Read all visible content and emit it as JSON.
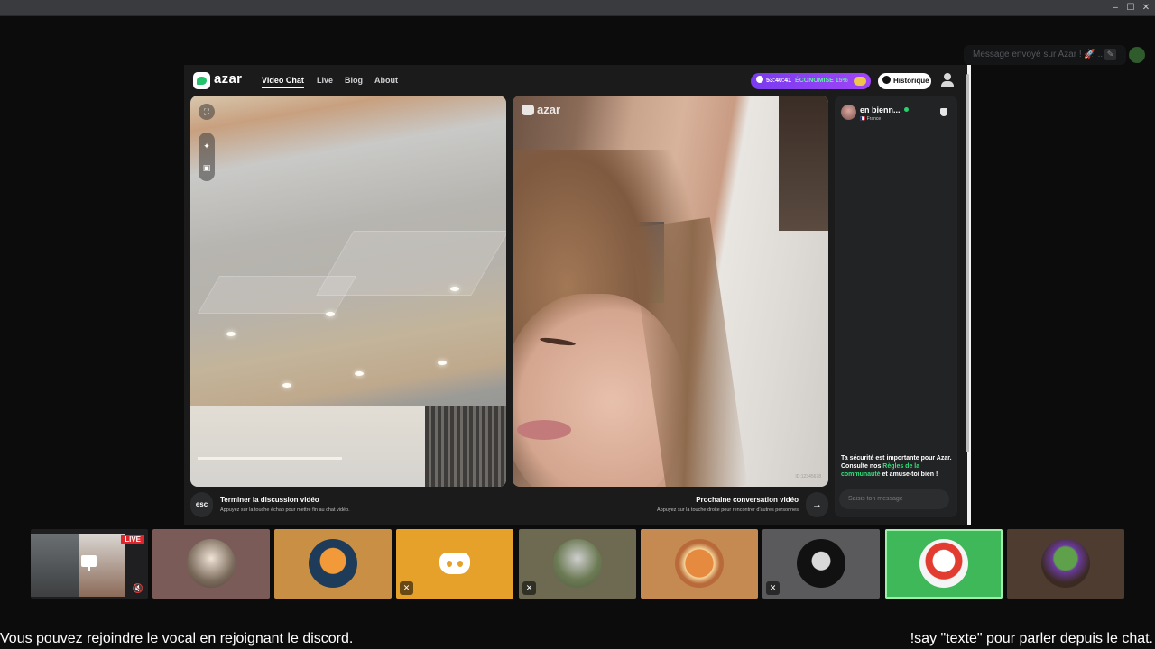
{
  "azar": {
    "brand": "azar",
    "nav": [
      {
        "label": "Video Chat",
        "active": true
      },
      {
        "label": "Live",
        "active": false
      },
      {
        "label": "Blog",
        "active": false
      },
      {
        "label": "About",
        "active": false
      }
    ],
    "promo": {
      "timer": "53:40:41",
      "discount": "ÉCONOMISE 15%"
    },
    "history_label": "Historique",
    "partner": {
      "name": "en bienn...",
      "country": "🇫🇷 France"
    },
    "safety": {
      "text_before": "Ta sécurité est importante pour Azar. Consulte nos ",
      "link": "Règles de la communauté",
      "text_after": " et amuse-toi bien !"
    },
    "message_placeholder": "Saisis ton message",
    "end_call": {
      "key": "esc",
      "title": "Terminer la discussion vidéo",
      "subtitle": "Appuyez sur la touche échap pour mettre fin au chat vidéo."
    },
    "next_call": {
      "title": "Prochaine conversation vidéo",
      "subtitle": "Appuyez sur la touche droite pour rencontrer d'autres personnes"
    },
    "watermark": "ID:12345678"
  },
  "overlay": {
    "message_placeholder": "Message envoyé sur Azar ! 🚀 ..."
  },
  "participants": [
    {
      "type": "stream",
      "live_label": "LIVE",
      "bg": "#1f1f21"
    },
    {
      "type": "avatar",
      "bg": "#7b5b57",
      "muted": false
    },
    {
      "type": "avatar",
      "bg": "#c98f45",
      "muted": false
    },
    {
      "type": "discord",
      "bg": "#e6a12a",
      "muted": true
    },
    {
      "type": "avatar",
      "bg": "#6e6a52",
      "muted": true
    },
    {
      "type": "avatar",
      "bg": "#c48a52",
      "muted": false
    },
    {
      "type": "avatar",
      "bg": "#5a5a5c",
      "muted": true
    },
    {
      "type": "avatar",
      "bg": "#3fb85a",
      "muted": false,
      "active_speaker": true
    },
    {
      "type": "avatar",
      "bg": "#4e3c30",
      "muted": false
    }
  ],
  "footer": {
    "left": "Vous pouvez rejoindre le vocal en rejoignant le discord.",
    "right": "!say \"texte\" pour parler depuis le chat."
  },
  "colors": {
    "accent_green": "#2fe27a",
    "promo_purple": "#8e40f4",
    "live_red": "#e0262d"
  }
}
